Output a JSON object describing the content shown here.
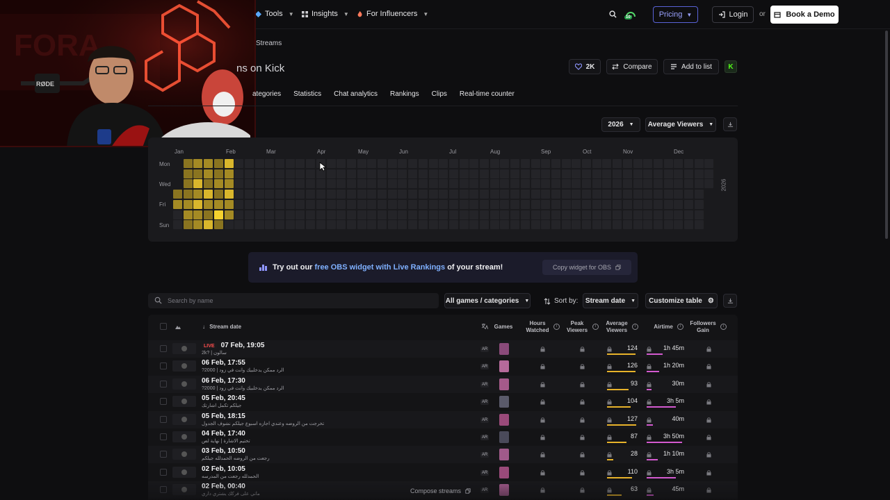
{
  "nav": {
    "tools": "Tools",
    "insights": "Insights",
    "influencers": "For Influencers",
    "badge": "10",
    "pricing": "Pricing",
    "login": "Login",
    "or": "or",
    "demo": "Book a Demo"
  },
  "breadcrumb": "Streams",
  "title": "ns on Kick",
  "header_actions": {
    "favorites_count": "2K",
    "compare": "Compare",
    "add_to_list": "Add to list",
    "kick_logo": "K"
  },
  "tabs": [
    "ategories",
    "Statistics",
    "Chat analytics",
    "Rankings",
    "Clips",
    "Real-time counter"
  ],
  "heatmap": {
    "year": "2026",
    "metric": "Average Viewers",
    "months": [
      "Jan",
      "Feb",
      "Mar",
      "Apr",
      "May",
      "Jun",
      "Jul",
      "Aug",
      "Sep",
      "Oct",
      "Nov",
      "Dec"
    ],
    "day_labels": [
      "Mon",
      "Wed",
      "Fri",
      "Sun"
    ],
    "year_label": "2026",
    "colors": {
      "empty": "#242428",
      "low": "#8a7420",
      "mid": "#a48a24",
      "high": "#d9b62c",
      "peak": "#f5d12e"
    }
  },
  "promo": {
    "text_a": "Try out our ",
    "link": "free OBS widget with Live Rankings",
    "text_b": " of your stream!",
    "button": "Copy widget for OBS"
  },
  "controls": {
    "search_placeholder": "Search by name",
    "games_filter": "All games / categories",
    "sort_label": "Sort by:",
    "sort_value": "Stream date",
    "customize": "Customize table"
  },
  "table": {
    "headers": {
      "stream_date": "Stream date",
      "games": "Games",
      "hours_watched": "Hours Watched",
      "peak_viewers": "Peak Viewers",
      "average_viewers": "Average Viewers",
      "airtime": "Airtime",
      "followers_gain": "Followers Gain"
    },
    "live_label": "LIVE",
    "rows": [
      {
        "date": "07 Feb, 19:05",
        "title": "2k? | سالون",
        "lang": "AR",
        "avg": "124",
        "avg_pct": 0.9,
        "airtime": "1h 45m",
        "air_pct": 0.45,
        "live": true
      },
      {
        "date": "06 Feb, 17:55",
        "title": "الرد ممكن يدخلبيك وانت في زود | 2000?",
        "lang": "AR",
        "avg": "126",
        "avg_pct": 0.92,
        "airtime": "1h 20m",
        "air_pct": 0.35
      },
      {
        "date": "06 Feb, 17:30",
        "title": "الرد ممكن يدخلبيك وانت في زود | 2000?",
        "lang": "AR",
        "avg": "93",
        "avg_pct": 0.68,
        "airtime": "30m",
        "air_pct": 0.14
      },
      {
        "date": "05 Feb, 20:45",
        "title": "جيلكم تكمل اشارتك",
        "lang": "AR",
        "avg": "104",
        "avg_pct": 0.76,
        "airtime": "3h 5m",
        "air_pct": 0.8
      },
      {
        "date": "05 Feb, 18:15",
        "title": "تخرجت من الروضه وعندي اجازه اسبوع جيلكم نشوف الجدول",
        "lang": "AR",
        "avg": "127",
        "avg_pct": 0.93,
        "airtime": "40m",
        "air_pct": 0.18
      },
      {
        "date": "04 Feb, 17:40",
        "title": "تختيم الاشارة | نهاية لص",
        "lang": "AR",
        "avg": "87",
        "avg_pct": 0.63,
        "airtime": "3h 50m",
        "air_pct": 0.98
      },
      {
        "date": "03 Feb, 10:50",
        "title": "رجعت من الروضه الحمدلله جيلكم",
        "lang": "AR",
        "avg": "28",
        "avg_pct": 0.2,
        "airtime": "1h 10m",
        "air_pct": 0.3
      },
      {
        "date": "02 Feb, 10:05",
        "title": "الحمدلله رجعت من المدرسه",
        "lang": "AR",
        "avg": "110",
        "avg_pct": 0.8,
        "airtime": "3h 5m",
        "air_pct": 0.8
      },
      {
        "date": "02 Feb, 00:40",
        "title": "ماني على فركك يشتري داري",
        "lang": "AR",
        "avg": "63",
        "avg_pct": 0.46,
        "airtime": "45m",
        "air_pct": 0.2
      }
    ],
    "compose": "Compose streams"
  }
}
